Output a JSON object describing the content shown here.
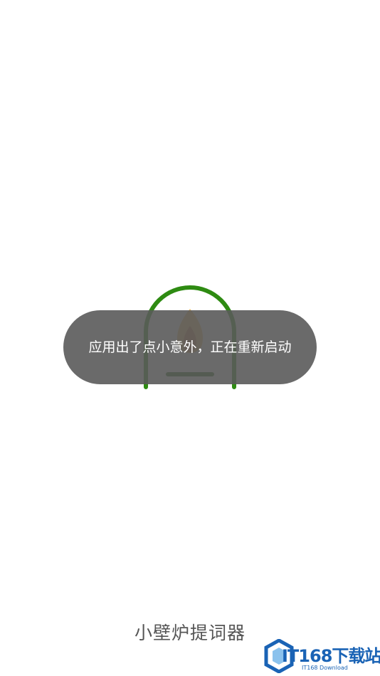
{
  "splash": {
    "app_name": "小壁炉提词器",
    "logo_icon": "fireplace-icon",
    "colors": {
      "arch": "#2e8b12",
      "flame": "#c8841c"
    }
  },
  "toast": {
    "message": "应用出了点小意外，正在重新启动"
  },
  "watermark": {
    "brand": "IT168下载站",
    "sub": "IT168 Download",
    "color": "#1a63b5"
  }
}
